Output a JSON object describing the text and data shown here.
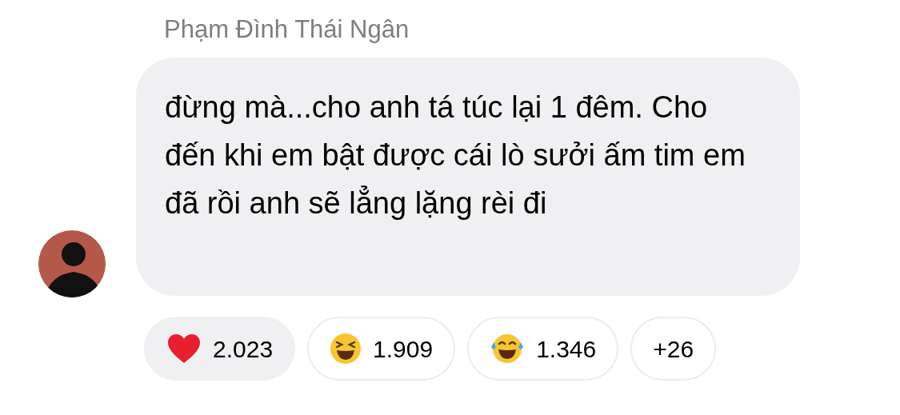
{
  "message": {
    "sender": "Phạm Đình Thái Ngân",
    "text": "đừng mà...cho anh tá túc lại 1 đêm. Cho đến khi em bật được cái lò sưởi ấm tim em đã rồi anh sẽ lẳng lặng rèi đi"
  },
  "reactions": [
    {
      "kind": "heart",
      "count": "2.023",
      "selected": true
    },
    {
      "kind": "laughing",
      "count": "1.909",
      "selected": false
    },
    {
      "kind": "tears-of-joy",
      "count": "1.346",
      "selected": false
    },
    {
      "kind": "more",
      "count": "+26",
      "selected": false
    }
  ]
}
